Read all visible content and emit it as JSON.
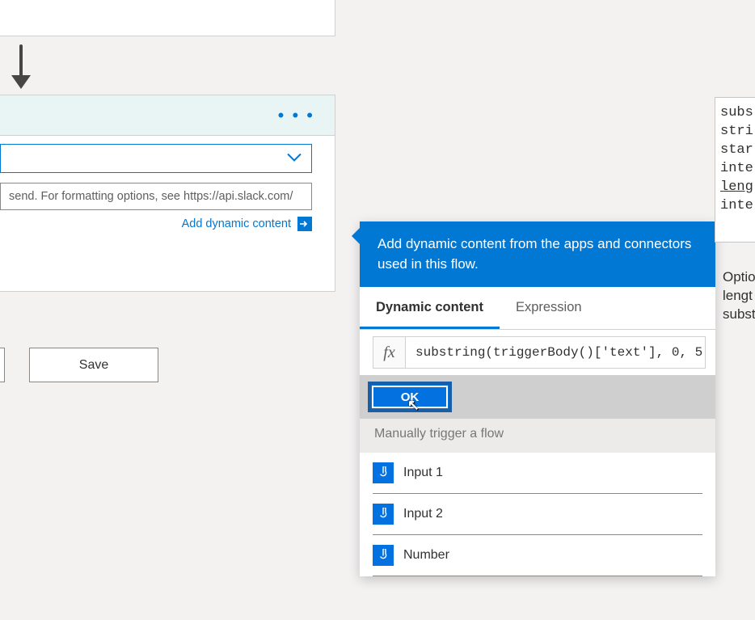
{
  "arrow": {
    "name": "flow-connector-arrow"
  },
  "action_card": {
    "dropdown_value": "",
    "text_placeholder": "send. For formatting options, see https://api.slack.com/",
    "add_dynamic_label": "Add dynamic content"
  },
  "buttons": {
    "save": "Save"
  },
  "dynamic_panel": {
    "header": "Add dynamic content from the apps and connectors used in this flow.",
    "tabs": {
      "dynamic": "Dynamic content",
      "expression": "Expression"
    },
    "fx_label": "fx",
    "expression_value": "substring(triggerBody()['text'], 0, 5)",
    "ok_label": "OK",
    "section_label": "Manually trigger a flow",
    "items": [
      {
        "label": "Input 1"
      },
      {
        "label": "Input 2"
      },
      {
        "label": "Number"
      }
    ]
  },
  "doc_hint": {
    "lines": [
      "subs",
      "stri",
      "star",
      "inte",
      "leng",
      "inte"
    ]
  },
  "doc_hint2": {
    "lines": [
      "Optio",
      "lengt",
      "subst"
    ]
  }
}
